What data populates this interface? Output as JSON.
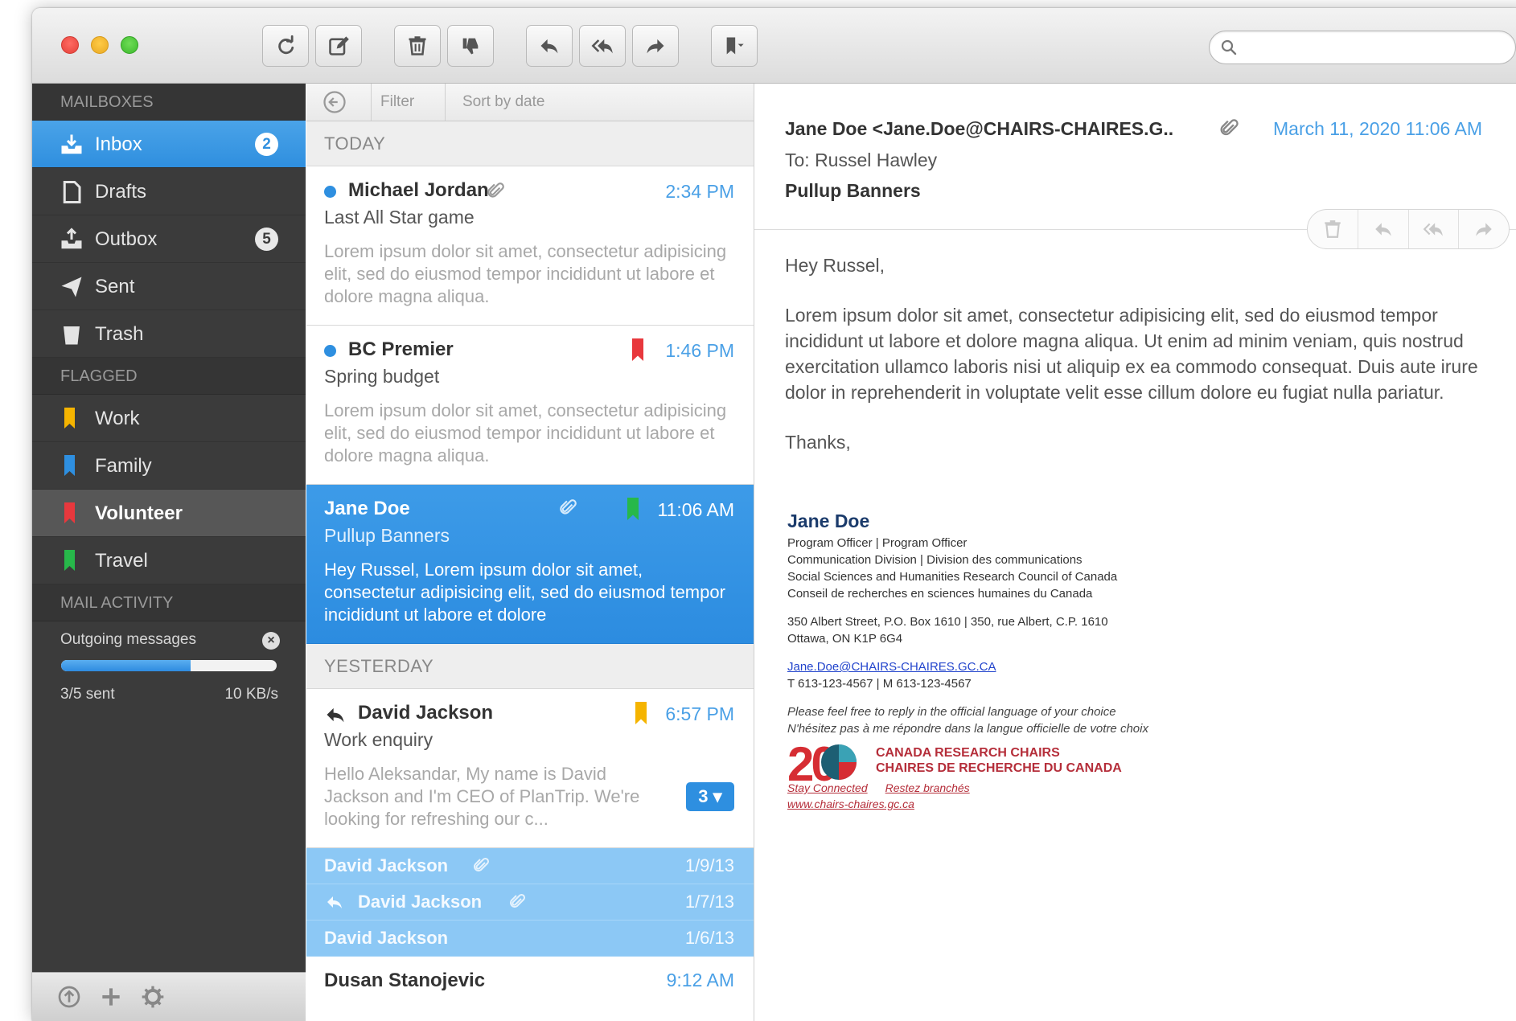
{
  "search": {
    "placeholder": "",
    "value": ""
  },
  "sidebar": {
    "mailboxes_header": "MAILBOXES",
    "mailboxes": [
      {
        "label": "Inbox",
        "icon": "inbox-icon",
        "badge": "2"
      },
      {
        "label": "Drafts",
        "icon": "document-icon",
        "badge": ""
      },
      {
        "label": "Outbox",
        "icon": "outbox-icon",
        "badge": "5"
      },
      {
        "label": "Sent",
        "icon": "paper-plane-icon",
        "badge": ""
      },
      {
        "label": "Trash",
        "icon": "trash-icon",
        "badge": ""
      }
    ],
    "flagged_header": "FLAGGED",
    "flagged": [
      {
        "label": "Work",
        "color": "#f5b400"
      },
      {
        "label": "Family",
        "color": "#2e8fe0"
      },
      {
        "label": "Volunteer",
        "color": "#e8383d"
      },
      {
        "label": "Travel",
        "color": "#27b84a"
      }
    ],
    "activity_header": "MAIL ACTIVITY",
    "activity": {
      "label": "Outgoing messages",
      "progress": 0.6,
      "sent": "3/5 sent",
      "speed": "10 KB/s"
    }
  },
  "list": {
    "filter": "Filter",
    "sort": "Sort by date",
    "today": "TODAY",
    "yesterday": "YESTERDAY",
    "messages": [
      {
        "from": "Michael Jordan",
        "subject": "Last All Star game",
        "preview": "Lorem ipsum dolor sit amet, consectetur adipisicing elit, sed do eiusmod tempor incididunt ut labore et dolore magna aliqua.",
        "time": "2:34 PM"
      },
      {
        "from": "BC Premier",
        "subject": "Spring budget",
        "preview": "Lorem ipsum dolor sit amet, consectetur adipisicing elit, sed do eiusmod tempor incididunt ut labore et dolore magna aliqua.",
        "time": "1:46 PM"
      },
      {
        "from": "Jane Doe",
        "subject": "Pullup Banners",
        "preview": "Hey Russel, Lorem ipsum dolor sit amet, consectetur adipisicing elit, sed do eiusmod tempor incididunt ut labore et dolore",
        "time": "11:06 AM"
      },
      {
        "from": "David Jackson",
        "subject": "Work enquiry",
        "preview": "Hello Aleksandar, My name is David Jackson and I'm CEO of PlanTrip. We're looking for refreshing our c...",
        "time": "6:57 PM",
        "thread_count": "3 ▾"
      }
    ],
    "thread": [
      {
        "from": "David Jackson",
        "date": "1/9/13"
      },
      {
        "from": "David Jackson",
        "date": "1/7/13"
      },
      {
        "from": "David Jackson",
        "date": "1/6/13"
      }
    ],
    "last": {
      "from": "Dusan Stanojevic",
      "time": "9:12 AM"
    }
  },
  "reader": {
    "from": "Jane Doe <Jane.Doe@CHAIRS-CHAIRES.G..",
    "date": "March 11, 2020 11:06 AM",
    "to": "To: Russel Hawley",
    "subject": "Pullup Banners",
    "greeting": "Hey Russel,",
    "body": "Lorem ipsum dolor sit amet, consectetur adipisicing elit, sed do eiusmod tempor incididunt ut labore et dolore magna aliqua. Ut enim ad minim veniam, quis nostrud exercitation ullamco laboris nisi ut aliquip ex ea commodo consequat. Duis aute irure dolor in reprehenderit in voluptate velit esse cillum dolore eu fugiat nulla pariatur.",
    "closing": "Thanks,",
    "signature": {
      "name": "Jane Doe",
      "title": "Program Officer   | Program Officer",
      "division": "Communication Division | Division des communications",
      "council_en": "Social Sciences and Humanities Research Council of Canada",
      "council_fr": "Conseil de recherches en sciences humaines du Canada",
      "address": "350 Albert Street, P.O. Box 1610  |  350, rue Albert, C.P. 1610",
      "city": "Ottawa, ON   K1P 6G4",
      "email": "Jane.Doe@CHAIRS-CHAIRES.GC.CA",
      "phone": "T  613-123-4567  |  M  613-123-4567",
      "note_en": "Please feel free to reply in the official language of your choice",
      "note_fr": "N'hésitez pas à me répondre dans la langue officielle de votre choix",
      "logo_number": "20",
      "logo_line1": "CANADA RESEARCH CHAIRS",
      "logo_line2": "CHAIRES DE RECHERCHE DU CANADA",
      "stay": "Stay Connected",
      "restez": "Restez branchés",
      "website": "www.chairs-chaires.gc.ca"
    }
  },
  "colors": {
    "accent": "#2e8fe0",
    "sidebar": "#3b3b3b"
  }
}
